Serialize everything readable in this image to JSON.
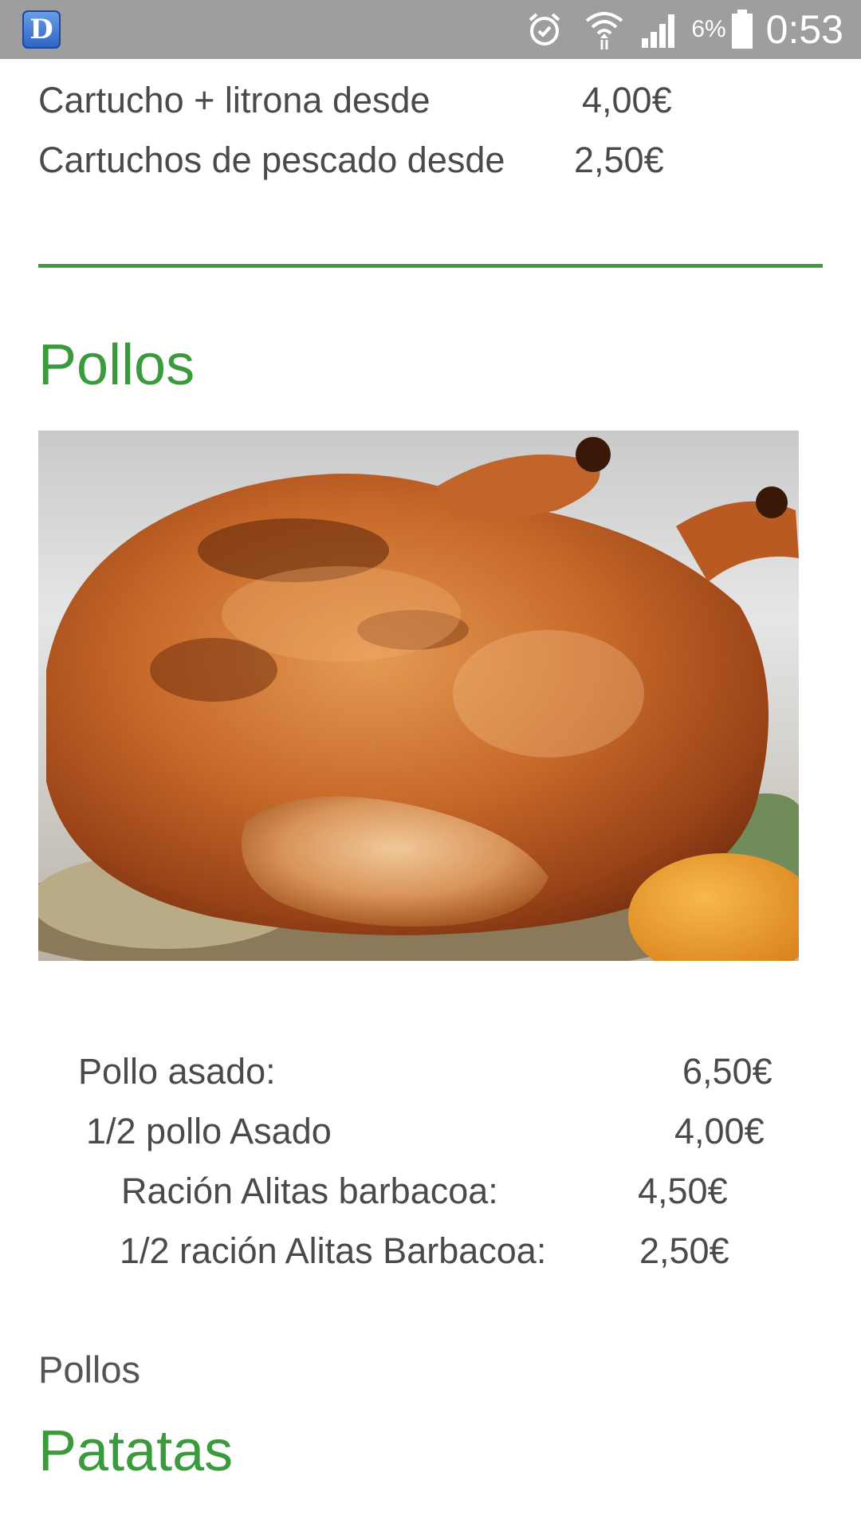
{
  "status_bar": {
    "app_icon_letter": "D",
    "battery_percent": "6%",
    "time": "0:53",
    "icons": [
      "alarm-icon",
      "wifi-icon",
      "signal-icon",
      "battery-icon"
    ]
  },
  "top_prices": [
    {
      "label": "Cartucho + litrona desde",
      "price": "4,00€"
    },
    {
      "label": "Cartuchos de pescado desde",
      "price": "2,50€"
    }
  ],
  "section_pollos": {
    "title": "Pollos",
    "image_description_name": "roast-chicken-photo",
    "items": [
      {
        "label": "Pollo asado:",
        "price": "6,50€"
      },
      {
        "label": "1/2 pollo Asado",
        "price": "4,00€"
      },
      {
        "label": "Ración Alitas barbacoa:",
        "price": "4,50€"
      },
      {
        "label": "1/2 ración Alitas Barbacoa:",
        "price": "2,50€"
      }
    ],
    "caption": "Pollos"
  },
  "section_patatas": {
    "title": "Patatas"
  },
  "colors": {
    "accent_green": "#3a9a3c",
    "status_bar": "#9e9e9e",
    "text": "#4a4a4a"
  }
}
